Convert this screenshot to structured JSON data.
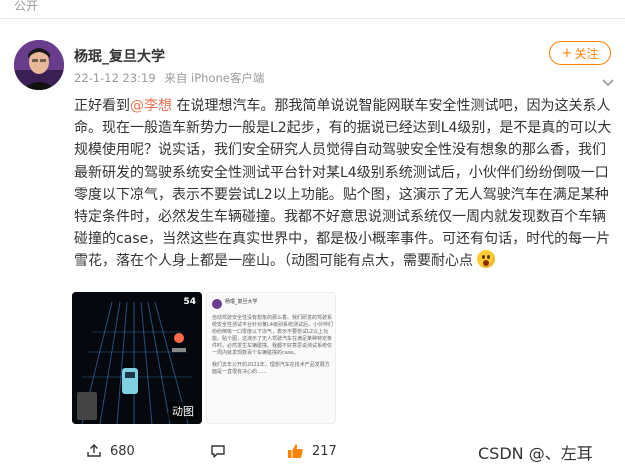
{
  "topbar": {
    "visibility": "公开"
  },
  "author": {
    "name": "杨珉_复旦大学",
    "time": "22-1-12 23:19",
    "source": "来自 iPhone客户端"
  },
  "follow_button": {
    "label": "关注",
    "icon": "plus-icon"
  },
  "post": {
    "lines": [
      {
        "before": "正好看到",
        "mention": "@李想",
        "after": " 在说理想汽车。那我简单说说智能网联车安全性测试吧，因为这关系人"
      },
      {
        "text": "命。现在一般造车新势力一般是L2起步，有的据说已经达到L4级别，是不是真的可以大"
      },
      {
        "text": "规模使用呢？说实话，我们安全研究人员觉得自动驾驶安全性没有想象的那么香，我们"
      },
      {
        "text": "最新研发的驾驶系统安全性测试平台针对某L4级别系统测试后，小伙伴们纷纷倒吸一口"
      },
      {
        "text": "零度以下凉气，表示不要尝试L2以上功能。贴个图，这演示了无人驾驶汽车在满足某种"
      },
      {
        "text": "特定条件时，必然发生车辆碰撞。我都不好意思说测试系统仅一周内就发现数百个车辆"
      },
      {
        "text": "碰撞的case，当然这些在真实世界中，都是极小概率事件。可还有句话，时代的每一片"
      },
      {
        "text": "雪花，落在个人身上都是一座山。（动图可能有点大，需要耐心点",
        "emoji": "wow-emoji"
      }
    ]
  },
  "media": {
    "gif": {
      "speed": "54",
      "badge": "动图"
    },
    "screenshot": {
      "name": "杨珉_复旦大学",
      "text": "自动驾驶安全性没有想象的那么香。我们研发的驾驶系统安全性测试平台针对某L4级别系统测试后，小伙伴们纷纷倒吸一口零度以下凉气，表示不要尝试L2以上功能。贴个图，这演示了无人驾驶汽车在满足某种特定条件时，必然发生车辆碰撞。我都不好意思说测试系统仅一周内就发现数百个车辆碰撞的case。",
      "text2": "我们去年公开的2021年，理想汽车在技术产品发展方面是一直很有决心的……"
    }
  },
  "actions": {
    "forward": "680",
    "comment": "",
    "like": "217"
  },
  "watermark": "CSDN @、左耳",
  "colors": {
    "accent": "#ff8200",
    "mention": "#eb7350",
    "text": "#333333",
    "muted": "#9a9a9a"
  }
}
